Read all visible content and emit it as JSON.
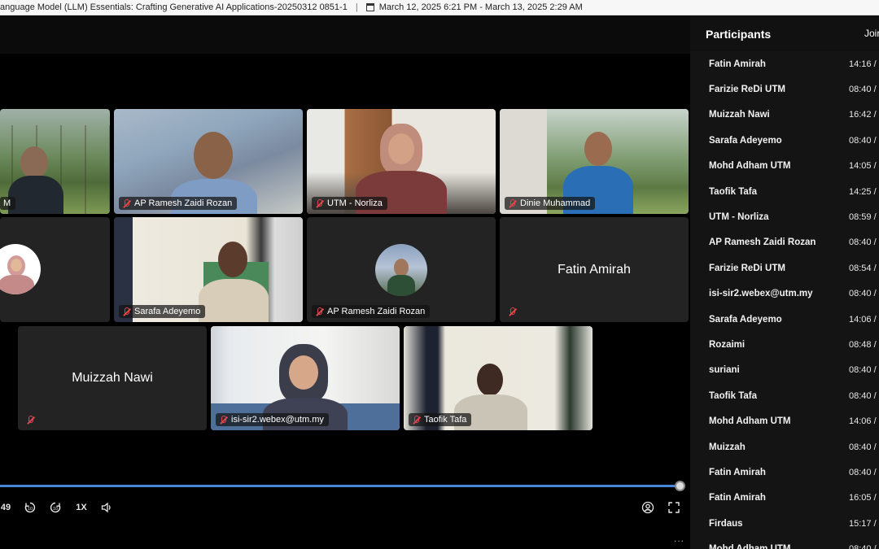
{
  "titlebar": {
    "title": "anguage Model (LLM) Essentials: Crafting Generative AI Applications-20250312 0851-1",
    "separator": "|",
    "date_range": "March 12, 2025 6:21 PM - March 13, 2025 2:29 AM"
  },
  "tiles": [
    {
      "name": "M"
    },
    {
      "name": "AP Ramesh Zaidi Rozan"
    },
    {
      "name": "UTM - Norliza"
    },
    {
      "name": "Dinie Muhammad"
    },
    {
      "name": ""
    },
    {
      "name": "Sarafa Adeyemo"
    },
    {
      "name": "AP Ramesh Zaidi Rozan"
    },
    {
      "name": "Fatin Amirah"
    },
    {
      "name": "Muizzah Nawi"
    },
    {
      "name": "isi-sir2.webex@utm.my"
    },
    {
      "name": "Taofik Tafa"
    }
  ],
  "playback": {
    "time": "49",
    "speed": "1X",
    "progress_fraction": 0.985,
    "more": "..."
  },
  "panel": {
    "title": "Participants",
    "join_header": "Joir",
    "participants": [
      {
        "name": "Fatin Amirah",
        "time": "14:16 /"
      },
      {
        "name": "Farizie ReDi UTM",
        "time": "08:40 /"
      },
      {
        "name": "Muizzah Nawi",
        "time": "16:42 /"
      },
      {
        "name": "Sarafa Adeyemo",
        "time": "08:40 /"
      },
      {
        "name": "Mohd Adham UTM",
        "time": "14:05 /"
      },
      {
        "name": "Taofik Tafa",
        "time": "14:25 /"
      },
      {
        "name": "UTM - Norliza",
        "time": "08:59 /"
      },
      {
        "name": "AP Ramesh Zaidi Rozan",
        "time": "08:40 /"
      },
      {
        "name": "Farizie ReDi UTM",
        "time": "08:54 /"
      },
      {
        "name": "isi-sir2.webex@utm.my",
        "time": "08:40 /"
      },
      {
        "name": "Sarafa Adeyemo",
        "time": "14:06 /"
      },
      {
        "name": "Rozaimi",
        "time": "08:48 /"
      },
      {
        "name": "suriani",
        "time": "08:40 /"
      },
      {
        "name": "Taofik Tafa",
        "time": "08:40 /"
      },
      {
        "name": "Mohd Adham UTM",
        "time": "14:06 /"
      },
      {
        "name": "Muizzah",
        "time": "08:40 /"
      },
      {
        "name": "Fatin Amirah",
        "time": "08:40 /"
      },
      {
        "name": "Fatin Amirah",
        "time": "16:05 /"
      },
      {
        "name": "Firdaus",
        "time": "15:17 /"
      },
      {
        "name": "Mohd Adham UTM",
        "time": "08:40 /"
      }
    ]
  }
}
